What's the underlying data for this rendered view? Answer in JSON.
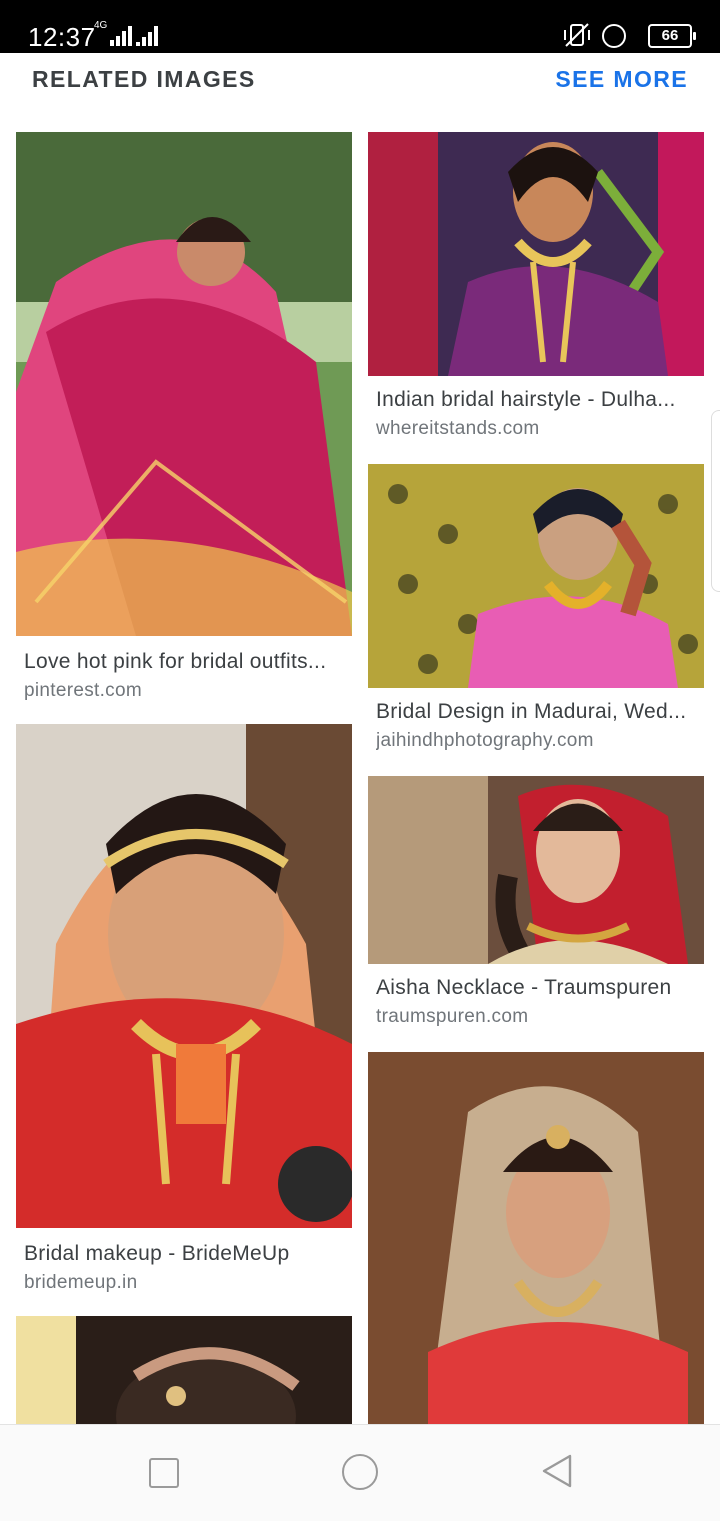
{
  "status_bar": {
    "time": "12:37",
    "network": "4G",
    "battery": "66"
  },
  "header": {
    "title": "RELATED IMAGES",
    "see_more": "SEE MORE"
  },
  "results": [
    {
      "title": "Love hot pink for bridal outfits...",
      "domain": "pinterest.com",
      "palette": [
        "#5d8a3e",
        "#c8d8a8",
        "#e8357a",
        "#b01e55",
        "#f2c94c"
      ]
    },
    {
      "title": "Indian bridal hairstyle - Dulha...",
      "domain": "whereitstands.com",
      "palette": [
        "#3e2a52",
        "#c2185b",
        "#e8c55a",
        "#7a3e8a",
        "#f1e6c4"
      ]
    },
    {
      "title": "Bridal Design in Madurai, Wed...",
      "domain": "jaihindhphotography.com",
      "palette": [
        "#b8a635",
        "#3a3a1e",
        "#e85db4",
        "#d4a017",
        "#6e6a2a"
      ]
    },
    {
      "title": "Aisha Necklace - Traumspuren",
      "domain": "traumspuren.com",
      "palette": [
        "#6b4e3d",
        "#c9a98a",
        "#c21f2e",
        "#e8d5b5",
        "#3b2a22"
      ]
    },
    {
      "title": "Bridal makeup - BrideMeUp",
      "domain": "bridemeup.in",
      "palette": [
        "#5a3a2a",
        "#e24a2a",
        "#c41a2a",
        "#e0b878",
        "#f07a3a"
      ]
    },
    {
      "title": "",
      "domain": "",
      "palette": [
        "#7a4a2e",
        "#c96a3a",
        "#e03a3a",
        "#f0d8b0",
        "#4a2a1e"
      ]
    },
    {
      "title": "",
      "domain": "",
      "palette": [
        "#f0e0a0",
        "#3a2a22",
        "#b46a5a",
        "#d8c8a8",
        "#222"
      ]
    }
  ],
  "nav": {
    "recents": "recents-icon",
    "home": "home-icon",
    "back": "back-icon"
  }
}
